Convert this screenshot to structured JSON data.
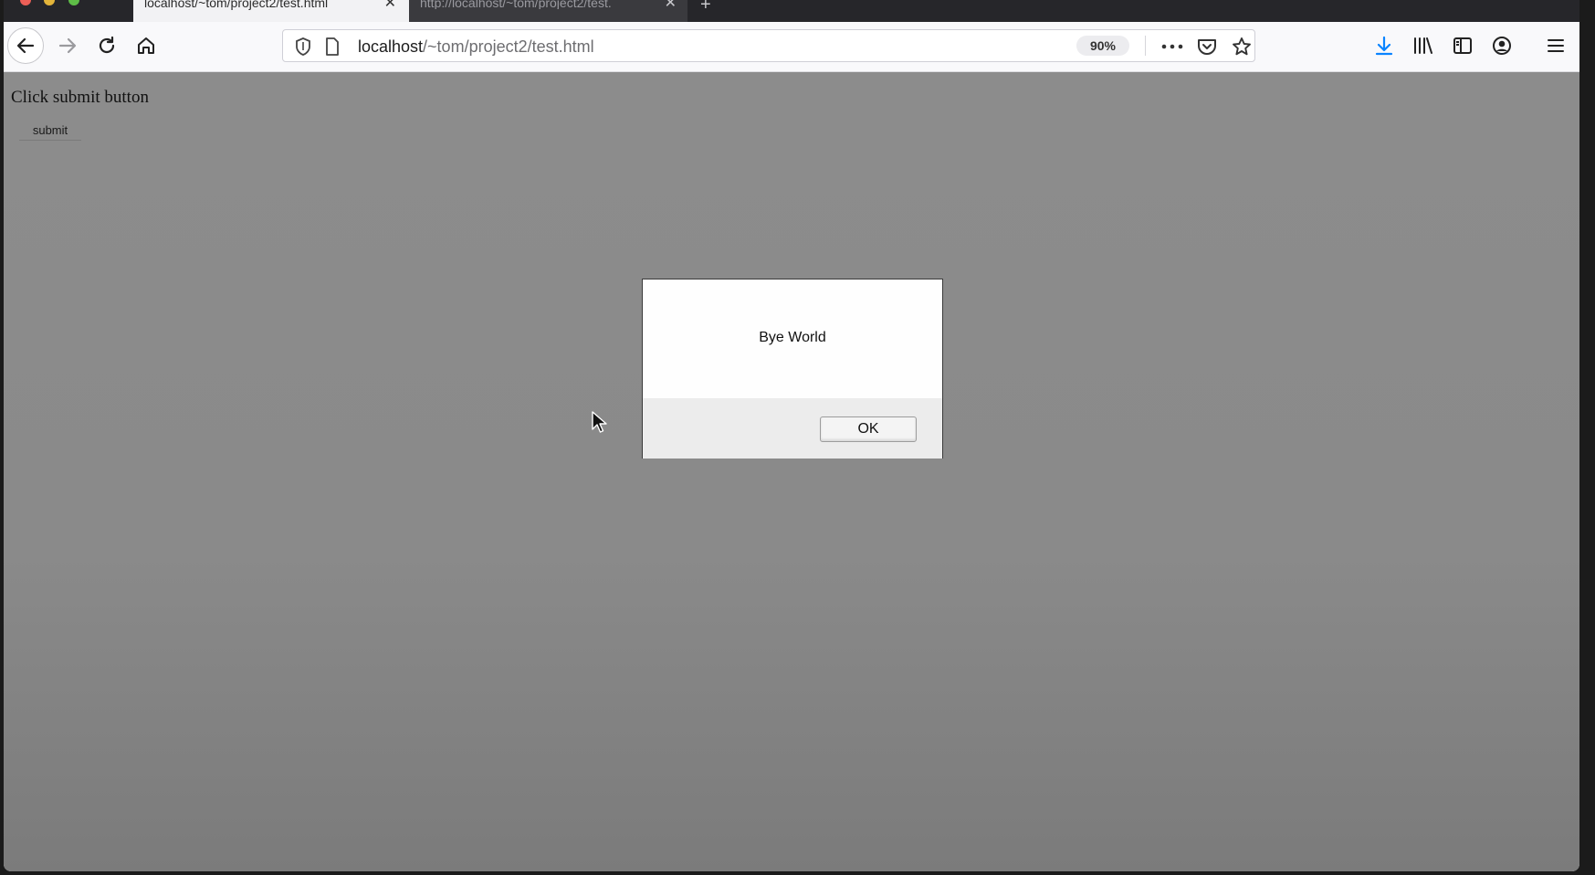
{
  "browser": {
    "tabs": [
      {
        "label": "localhost/~tom/project2/test.html",
        "active": true
      },
      {
        "label": "http://localhost/~tom/project2/test.",
        "active": false
      }
    ],
    "url_host": "localhost",
    "url_path": "/~tom/project2/test.html",
    "zoom": "90%",
    "icons": [
      "back-icon",
      "forward-icon",
      "reload-icon",
      "home-icon",
      "shield-icon",
      "page-icon",
      "more-icon",
      "pocket-icon",
      "star-icon",
      "download-icon",
      "library-icon",
      "sidebar-icon",
      "account-icon",
      "menu-icon"
    ],
    "accent_color": "#0a84ff"
  },
  "page": {
    "heading": "Click submit button",
    "submit_label": "submit"
  },
  "dialog": {
    "message": "Bye World",
    "ok_label": "OK"
  }
}
